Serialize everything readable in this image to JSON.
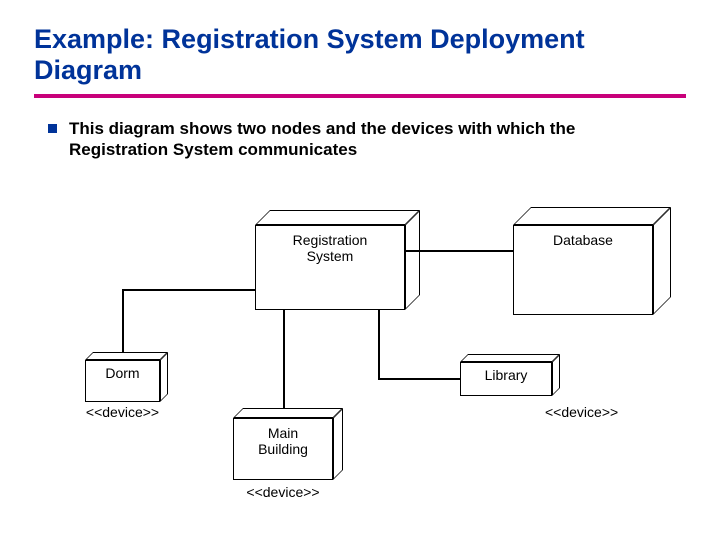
{
  "title": "Example: Registration System Deployment Diagram",
  "bullet_text": "This diagram shows two nodes and the devices with which the Registration System communicates",
  "nodes": {
    "registration_system": "Registration\nSystem",
    "database": "Database",
    "dorm": "Dorm",
    "library": "Library",
    "main_building": "Main\nBuilding"
  },
  "stereotypes": {
    "dorm": "<<device>>",
    "library": "<<device>>",
    "main_building": "<<device>>"
  },
  "colors": {
    "title": "#003399",
    "rule": "#c8007a",
    "bullet_marker": "#003399"
  }
}
